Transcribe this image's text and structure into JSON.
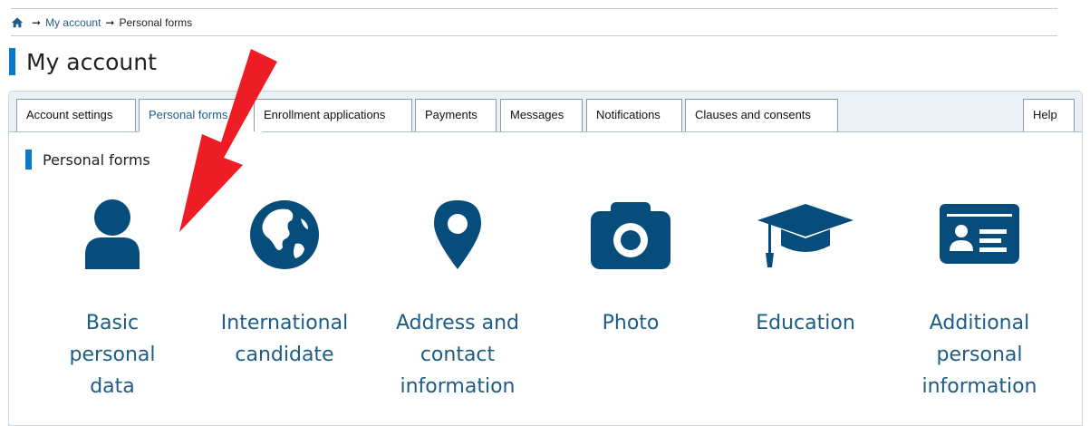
{
  "breadcrumb": {
    "home_icon": "home-icon",
    "link": "My account",
    "current": "Personal forms"
  },
  "page_title": "My account",
  "tabs": [
    {
      "label": "Account settings",
      "active": false
    },
    {
      "label": "Personal forms",
      "active": true
    },
    {
      "label": "Enrollment applications",
      "active": false
    },
    {
      "label": "Payments",
      "active": false
    },
    {
      "label": "Messages",
      "active": false
    },
    {
      "label": "Notifications",
      "active": false
    },
    {
      "label": "Clauses and consents",
      "active": false
    },
    {
      "label": "Help",
      "active": false
    }
  ],
  "section_title": "Personal forms",
  "tiles": [
    {
      "icon": "user-icon",
      "label_lines": [
        "Basic",
        "personal",
        "data"
      ]
    },
    {
      "icon": "globe-icon",
      "label_lines": [
        "International",
        "candidate"
      ]
    },
    {
      "icon": "map-pin-icon",
      "label_lines": [
        "Address and",
        "contact",
        "information"
      ]
    },
    {
      "icon": "camera-icon",
      "label_lines": [
        "Photo"
      ]
    },
    {
      "icon": "graduation-cap-icon",
      "label_lines": [
        "Education"
      ]
    },
    {
      "icon": "id-card-icon",
      "label_lines": [
        "Additional",
        "personal",
        "information"
      ]
    }
  ],
  "colors": {
    "icon": "#074d7c",
    "link": "#1d5c87",
    "accent_bar": "#0a79c8",
    "annotation_arrow": "#ee1c24"
  }
}
